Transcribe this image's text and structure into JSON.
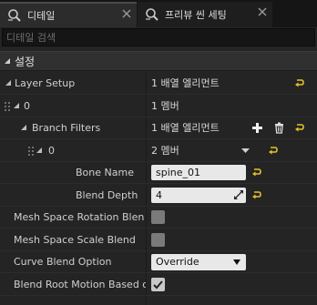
{
  "tabs": [
    {
      "label": "디테일",
      "icon": "details-search-icon",
      "active": true
    },
    {
      "label": "프리뷰 씬 세팅",
      "icon": "preview-search-icon",
      "active": false
    }
  ],
  "search": {
    "placeholder": "디테일 검색",
    "value": ""
  },
  "section": {
    "title": "설정"
  },
  "rows": {
    "layer_setup": {
      "label": "Layer Setup",
      "value": "1 배열 엘리먼트"
    },
    "layer_index": {
      "label": "0",
      "value": "1 멤버"
    },
    "branch_filters": {
      "label": "Branch Filters",
      "value": "1 배열 엘리먼트"
    },
    "branch_index": {
      "label": "0",
      "value": "2 멤버"
    },
    "bone_name": {
      "label": "Bone Name",
      "value": "spine_01"
    },
    "blend_depth": {
      "label": "Blend Depth",
      "value": "4"
    },
    "mesh_rotation": {
      "label": "Mesh Space Rotation Blend",
      "checked": false
    },
    "mesh_scale": {
      "label": "Mesh Space Scale Blend",
      "checked": false
    },
    "curve_blend": {
      "label": "Curve Blend Option",
      "value": "Override"
    },
    "root_motion": {
      "label": "Blend Root Motion Based on Root Bone",
      "checked": true
    }
  },
  "colors": {
    "reset_arrow": "#e6c229",
    "background": "#242424",
    "section": "#303030"
  }
}
